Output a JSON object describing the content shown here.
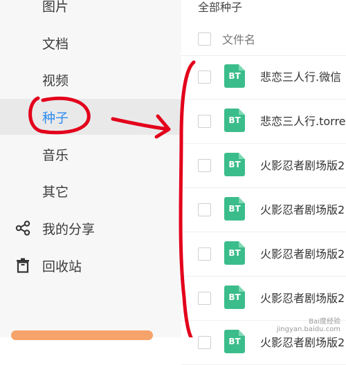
{
  "sidebar": {
    "items": [
      {
        "label": "图片"
      },
      {
        "label": "文档"
      },
      {
        "label": "视频"
      },
      {
        "label": "种子"
      },
      {
        "label": "音乐"
      },
      {
        "label": "其它"
      },
      {
        "label": "我的分享",
        "icon": "share-icon"
      },
      {
        "label": "回收站",
        "icon": "trash-icon"
      }
    ],
    "active_item": "种子"
  },
  "main": {
    "breadcrumb": "全部种子",
    "column_header": "文件名",
    "file_type_badge": "BT",
    "files": [
      {
        "name": "悲恋三人行.微信"
      },
      {
        "name": "悲恋三人行.torre"
      },
      {
        "name": "火影忍者剧场版2"
      },
      {
        "name": "火影忍者剧场版2"
      },
      {
        "name": "火影忍者剧场版2"
      },
      {
        "name": "火影忍者剧场版2"
      },
      {
        "name": "火影忍者剧场版2"
      }
    ]
  },
  "watermark": {
    "line1": "Bai度经验",
    "line2": "jingyan.baidu.com"
  },
  "colors": {
    "active": "#2f8cf0",
    "annotation": "#e3001b",
    "bt_badge": "#3bbd8b",
    "bottom_bar": "#f6a36b"
  }
}
